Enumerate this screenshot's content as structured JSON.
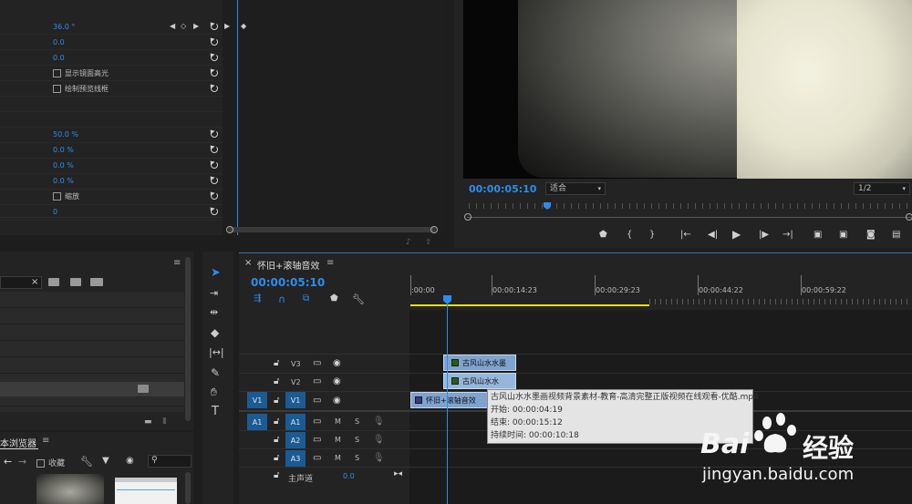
{
  "effect_controls": {
    "rows": [
      {
        "value": "36.0 °",
        "keyframe": true
      },
      {
        "value": "0.0"
      },
      {
        "value": "0.0"
      },
      {
        "checkbox_label": "显示镜面高光"
      },
      {
        "checkbox_label": "绘制预览线框"
      },
      {
        "value": "50.0 %"
      },
      {
        "value": "0.0 %"
      },
      {
        "value": "0.0 %"
      },
      {
        "value": "0.0 %"
      },
      {
        "checkbox_label": "缩放"
      },
      {
        "value": "0"
      }
    ]
  },
  "program_monitor": {
    "timecode": "00:00:05:10",
    "fit_select": "适合",
    "resolution_select": "1/2"
  },
  "project_panel": {
    "browser_tab": "本浏览器",
    "favorites_label": "收藏"
  },
  "timeline": {
    "close": "×",
    "sequence_name": "怀旧+滚轴音效",
    "menu": "≡",
    "timecode": "00:00:05:10",
    "ruler_labels": [
      ":00:00",
      "00:00:14:23",
      "00:00:29:23",
      "00:00:44:22",
      "00:00:59:22"
    ],
    "tracks": {
      "v3": "V3",
      "v2": "V2",
      "v1": "V1",
      "v1_src": "V1",
      "a1": "A1",
      "a1_src": "A1",
      "a2": "A2",
      "a3": "A3",
      "mute": "M",
      "solo": "S",
      "master": "主声道",
      "master_value": "0.0"
    },
    "clips": {
      "v3": "古风山水水墨",
      "v2": "古风山水水",
      "v1": "怀旧+滚轴音效"
    },
    "tooltip": {
      "name": "古风山水水墨画视频背景素材-教育-高清完整正版视频在线观看-优酷.mp4",
      "start": "开始: 00:00:04:19",
      "end": "结束: 00:00:15:12",
      "duration": "持续时间: 00:00:10:18"
    }
  },
  "watermark": {
    "brand_left": "Bai",
    "brand_right": "经验",
    "url": "jingyan.baidu.com"
  },
  "colors": {
    "accent": "#2d8ceb",
    "track_button": "#1c5b92",
    "clip": "#7fa3cf",
    "work_area": "#e8e010"
  }
}
